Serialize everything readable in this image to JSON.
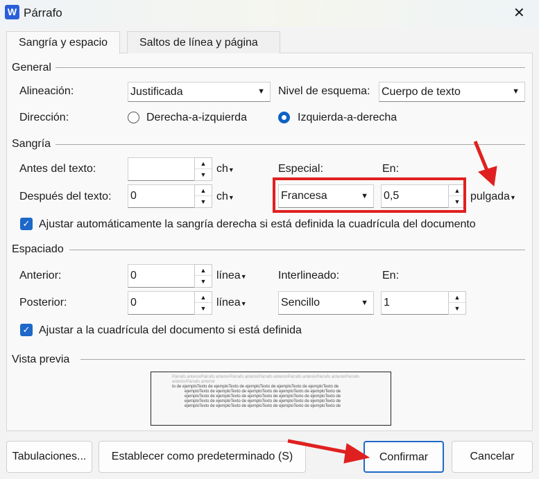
{
  "window": {
    "title": "Párrafo",
    "icon": "W",
    "close": "✕"
  },
  "tabs": [
    {
      "label": "Sangría y espacio",
      "active": true
    },
    {
      "label": "Saltos de línea y página",
      "active": false
    }
  ],
  "general": {
    "title": "General",
    "alignment_label": "Alineación:",
    "alignment_value": "Justificada",
    "outline_label": "Nivel de esquema:",
    "outline_value": "Cuerpo de texto",
    "direction_label": "Dirección:",
    "rtl_label": "Derecha-a-izquierda",
    "ltr_label": "Izquierda-a-derecha",
    "selected_direction": "ltr"
  },
  "indent": {
    "title": "Sangría",
    "before_label": "Antes del texto:",
    "before_value": "",
    "before_unit": "ch",
    "after_label": "Después del texto:",
    "after_value": "0",
    "after_unit": "ch",
    "special_label": "Especial:",
    "special_value": "Francesa",
    "by_label": "En:",
    "by_value": "0,5",
    "by_unit": "pulgada",
    "auto_adjust_label": "Ajustar automáticamente la sangría derecha si está definida la cuadrícula del documento",
    "auto_adjust_checked": true
  },
  "spacing": {
    "title": "Espaciado",
    "before_label": "Anterior:",
    "before_value": "0",
    "before_unit": "línea",
    "after_label": "Posterior:",
    "after_value": "0",
    "after_unit": "línea",
    "line_label": "Interlineado:",
    "line_value": "Sencillo",
    "at_label": "En:",
    "at_value": "1",
    "grid_label": "Ajustar a la cuadrícula del documento si está definida",
    "grid_checked": true
  },
  "preview": {
    "title": "Vista previa",
    "prev_text": "Párrafo anteriorPárrafo anteriorPárrafo anteriorPárrafo anteriorPárrafo anteriorPárrafo anteriorPárrafo anteriorPárrafo anterior",
    "first_line": "to de ejemploTexto de ejemploTexto de ejemploTexto de ejemploTexto de ejemploTexto de",
    "body_line": "ejemploTexto de ejemploTexto de ejemploTexto de ejemploTexto de ejemploTexto de"
  },
  "buttons": {
    "tabs": "Tabulaciones...",
    "default": "Establecer como predeterminado (S)",
    "ok": "Confirmar",
    "cancel": "Cancelar"
  },
  "colors": {
    "accent": "#1d68c8",
    "annotation": "#e02020"
  }
}
